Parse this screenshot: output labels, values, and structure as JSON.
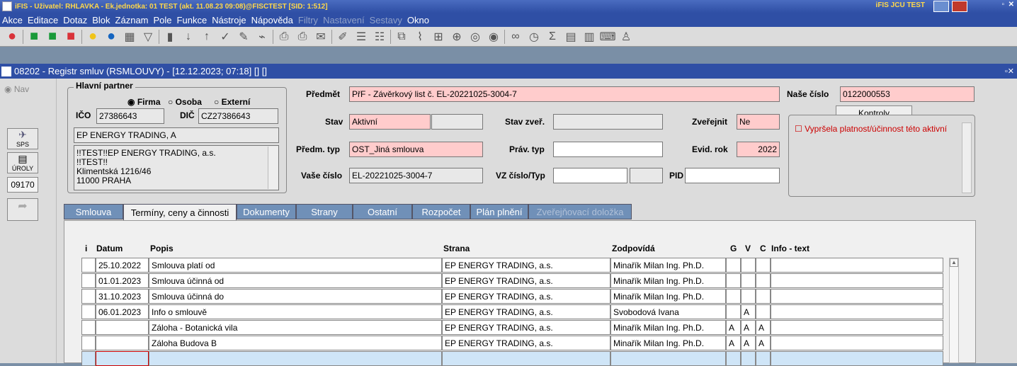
{
  "titlebar": {
    "text": "iFIS - Uživatel: RHLAVKA - Ek.jednotka: 01 TEST (akt. 11.08.23 09:08)@FISCTEST  [SID: 1:512]",
    "right_text": "iFIS JCU TEST"
  },
  "menu": {
    "items": [
      "Akce",
      "Editace",
      "Dotaz",
      "Blok",
      "Záznam",
      "Pole",
      "Funkce",
      "Nástroje",
      "Nápověda"
    ],
    "disabled_items": [
      "Filtry",
      "Nastavení",
      "Sestavy"
    ],
    "last": "Okno"
  },
  "form_title": "08202 - Registr smluv (RSMLOUVY) - [12.12.2023; 07:18] [] []",
  "nav": {
    "label": "Nav",
    "btn_sps": "SPS",
    "btn_uroly": "ÚROLY",
    "code": "09170"
  },
  "partner": {
    "group_label": "Hlavní partner",
    "opt_firma": "Firma",
    "opt_osoba": "Osoba",
    "opt_externi": "Externí",
    "ico_label": "IČO",
    "ico": "27386643",
    "dic_label": "DIČ",
    "dic": "CZ27386643",
    "name": "EP ENERGY TRADING, A",
    "address": [
      "!!TEST!!EP ENERGY TRADING, a.s.",
      "!!TEST!!",
      "Klimentská 1216/46",
      "11000 PRAHA"
    ]
  },
  "fields": {
    "predmet_label": "Předmět",
    "predmet": "PřF - Závěrkový list č. EL-20221025-3004-7",
    "nase_cislo_label": "Naše číslo",
    "nase_cislo": "0122000553",
    "kontroly_label": "Kontroly",
    "kontroly_item": "Vypršela platnost/účinnost této aktivní",
    "stav_label": "Stav",
    "stav": "Aktivní",
    "stav_zver_label": "Stav zveř.",
    "zverejnit_label": "Zveřejnit",
    "zverejnit": "Ne",
    "predm_typ_label": "Předm. typ",
    "predm_typ": "OST_Jiná smlouva",
    "prav_typ_label": "Práv. typ",
    "evid_rok_label": "Evid. rok",
    "evid_rok": "2022",
    "vase_cislo_label": "Vaše číslo",
    "vase_cislo": "EL-20221025-3004-7",
    "vz_label": "VZ číslo/Typ",
    "pid_label": "PID"
  },
  "tabs": [
    {
      "label": "Smlouva"
    },
    {
      "label": "Termíny, ceny a činnosti"
    },
    {
      "label": "Dokumenty"
    },
    {
      "label": "Strany"
    },
    {
      "label": "Ostatní"
    },
    {
      "label": "Rozpočet"
    },
    {
      "label": "Plán plnění"
    },
    {
      "label": "Zveřejňovací doložka"
    }
  ],
  "table": {
    "headers": {
      "i": "i",
      "datum": "Datum",
      "popis": "Popis",
      "strana": "Strana",
      "zodpovida": "Zodpovídá",
      "g": "G",
      "v": "V",
      "c": "C",
      "info": "Info - text"
    },
    "rows": [
      {
        "datum": "25.10.2022",
        "popis": "Smlouva platí od",
        "strana": "EP ENERGY TRADING, a.s.",
        "zodpovida": "Minařík Milan Ing. Ph.D.",
        "g": "",
        "v": "",
        "c": ""
      },
      {
        "datum": "01.01.2023",
        "popis": "Smlouva účinná od",
        "strana": "EP ENERGY TRADING, a.s.",
        "zodpovida": "Minařík Milan Ing. Ph.D.",
        "g": "",
        "v": "",
        "c": ""
      },
      {
        "datum": "31.10.2023",
        "popis": "Smlouva účinná do",
        "strana": "EP ENERGY TRADING, a.s.",
        "zodpovida": "Minařík Milan Ing. Ph.D.",
        "g": "",
        "v": "",
        "c": ""
      },
      {
        "datum": "06.01.2023",
        "popis": "Info o smlouvě",
        "strana": "EP ENERGY TRADING, a.s.",
        "zodpovida": "Svobodová Ivana",
        "g": "",
        "v": "A",
        "c": ""
      },
      {
        "datum": "",
        "popis": "Záloha - Botanická vila",
        "strana": "EP ENERGY TRADING, a.s.",
        "zodpovida": "Minařík Milan Ing. Ph.D.",
        "g": "A",
        "v": "A",
        "c": "A"
      },
      {
        "datum": "",
        "popis": "Záloha Budova B",
        "strana": "EP ENERGY TRADING, a.s.",
        "zodpovida": "Minařík Milan Ing. Ph.D.",
        "g": "A",
        "v": "A",
        "c": "A"
      }
    ]
  },
  "colors": {
    "title_bg": "#2f4fa5",
    "pink_field": "#ffcccc",
    "form_bg": "#dcdcdc"
  }
}
